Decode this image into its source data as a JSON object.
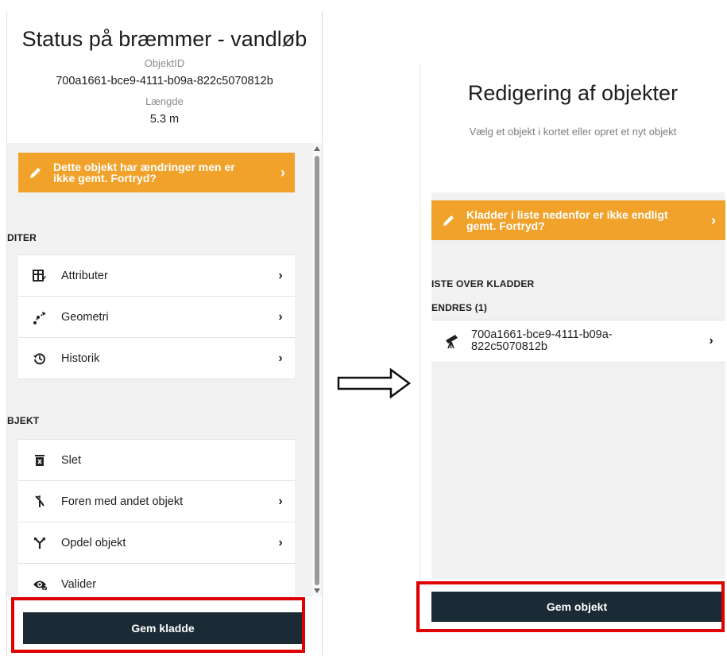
{
  "left": {
    "title": "Status på bræmmer - vandløb",
    "objekt_id_label": "ObjektID",
    "objekt_id_value": "700a1661-bce9-4111-b09a-822c5070812b",
    "length_label": "Længde",
    "length_value": "5.3 m",
    "warning": "Dette objekt har ændringer men er\nikke gemt. Fortryd?",
    "section_rediger": "DITER",
    "rediger_items": [
      {
        "label": "Attributer",
        "icon": "attributes-icon"
      },
      {
        "label": "Geometri",
        "icon": "geometry-icon"
      },
      {
        "label": "Historik",
        "icon": "history-icon"
      }
    ],
    "section_objekt": "BJEKT",
    "objekt_items": [
      {
        "label": "Slet",
        "icon": "trash-icon"
      },
      {
        "label": "Foren med andet objekt",
        "icon": "merge-icon"
      },
      {
        "label": "Opdel objekt",
        "icon": "split-icon"
      },
      {
        "label": "Valider",
        "icon": "eye-check-icon"
      }
    ],
    "save_button": "Gem kladde"
  },
  "right": {
    "title": "Redigering af objekter",
    "subtitle": "Vælg et objekt i kortet eller opret et nyt objekt",
    "warning": "Kladder i liste nedenfor er ikke endligt\ngemt. Fortryd?",
    "section_list": "ISTE OVER KLADDER",
    "group_label": "ENDRES (1)",
    "draft_item": "700a1661-bce9-4111-b09a-\n822c5070812b",
    "draft_icon": "telescope-icon",
    "save_button": "Gem objekt"
  },
  "colors": {
    "warning": "#f0a22b",
    "button": "#1b2b35",
    "highlight": "#e00000",
    "panel_bg": "#f1f1f1"
  }
}
